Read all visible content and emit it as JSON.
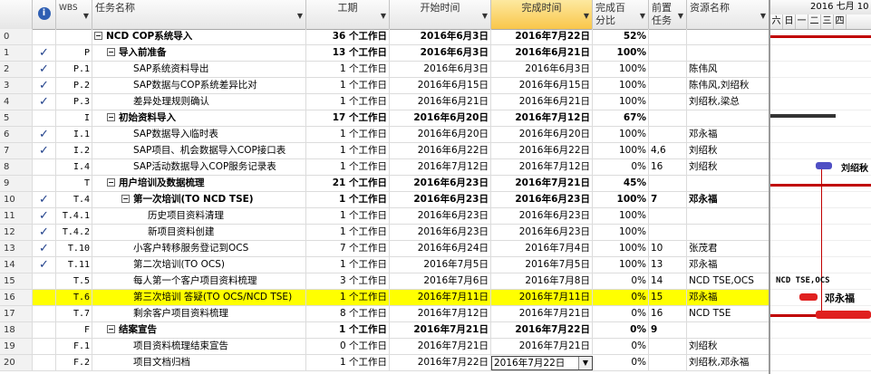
{
  "header": {
    "info": "i",
    "wbs": "WBS",
    "name": "任务名称",
    "duration": "工期",
    "start": "开始时间",
    "finish": "完成时间",
    "pct_line1": "完成百",
    "pct_line2": "分比",
    "pred_line1": "前置",
    "pred_line2": "任务",
    "resource": "资源名称"
  },
  "gantt": {
    "month_label": "2016 七月 10",
    "days": [
      "六",
      "日",
      "一",
      "二",
      "三",
      "四"
    ],
    "labels": {
      "r8": "刘绍秋",
      "r15": "NCD TSE,OCS",
      "r16": "邓永福"
    },
    "colors": {
      "summary": "#c00000",
      "task": "#4f4fc4",
      "critical": "#e0201f"
    }
  },
  "rows": [
    {
      "id": "0",
      "check": false,
      "wbs": "",
      "indent": 0,
      "toggle": "−",
      "name": "NCD COP系统导入",
      "dur": "36 个工作日",
      "start": "2016年6月3日",
      "end": "2016年7月22日",
      "pct": "52%",
      "pred": "",
      "res": "",
      "bold": true
    },
    {
      "id": "1",
      "check": true,
      "wbs": "P",
      "indent": 1,
      "toggle": "−",
      "name": "导入前准备",
      "dur": "13 个工作日",
      "start": "2016年6月3日",
      "end": "2016年6月21日",
      "pct": "100%",
      "pred": "",
      "res": "",
      "bold": true
    },
    {
      "id": "2",
      "check": true,
      "wbs": "P.1",
      "indent": 2,
      "toggle": "",
      "name": "SAP系统资料导出",
      "dur": "1 个工作日",
      "start": "2016年6月3日",
      "end": "2016年6月3日",
      "pct": "100%",
      "pred": "",
      "res": "陈伟风",
      "bold": false
    },
    {
      "id": "3",
      "check": true,
      "wbs": "P.2",
      "indent": 2,
      "toggle": "",
      "name": "SAP数据与COP系统差异比对",
      "dur": "1 个工作日",
      "start": "2016年6月15日",
      "end": "2016年6月15日",
      "pct": "100%",
      "pred": "",
      "res": "陈伟风,刘绍秋",
      "bold": false
    },
    {
      "id": "4",
      "check": true,
      "wbs": "P.3",
      "indent": 2,
      "toggle": "",
      "name": "差异处理规则确认",
      "dur": "1 个工作日",
      "start": "2016年6月21日",
      "end": "2016年6月21日",
      "pct": "100%",
      "pred": "",
      "res": "刘绍秋,梁总",
      "bold": false
    },
    {
      "id": "5",
      "check": false,
      "wbs": "I",
      "indent": 1,
      "toggle": "−",
      "name": "初始资料导入",
      "dur": "17 个工作日",
      "start": "2016年6月20日",
      "end": "2016年7月12日",
      "pct": "67%",
      "pred": "",
      "res": "",
      "bold": true
    },
    {
      "id": "6",
      "check": true,
      "wbs": "I.1",
      "indent": 2,
      "toggle": "",
      "name": "SAP数据导入临时表",
      "dur": "1 个工作日",
      "start": "2016年6月20日",
      "end": "2016年6月20日",
      "pct": "100%",
      "pred": "",
      "res": "邓永福",
      "bold": false
    },
    {
      "id": "7",
      "check": true,
      "wbs": "I.2",
      "indent": 2,
      "toggle": "",
      "name": "SAP项目、机会数据导入COP接口表",
      "dur": "1 个工作日",
      "start": "2016年6月22日",
      "end": "2016年6月22日",
      "pct": "100%",
      "pred": "4,6",
      "res": "刘绍秋",
      "bold": false
    },
    {
      "id": "8",
      "check": false,
      "wbs": "I.4",
      "indent": 2,
      "toggle": "",
      "name": "SAP活动数据导入COP服务记录表",
      "dur": "1 个工作日",
      "start": "2016年7月12日",
      "end": "2016年7月12日",
      "pct": "0%",
      "pred": "16",
      "res": "刘绍秋",
      "bold": false
    },
    {
      "id": "9",
      "check": false,
      "wbs": "T",
      "indent": 1,
      "toggle": "−",
      "name": "用户培训及数据梳理",
      "dur": "21 个工作日",
      "start": "2016年6月23日",
      "end": "2016年7月21日",
      "pct": "45%",
      "pred": "",
      "res": "",
      "bold": true
    },
    {
      "id": "10",
      "check": true,
      "wbs": "T.4",
      "indent": 2,
      "toggle": "−",
      "name": "第一次培训(TO NCD TSE)",
      "dur": "1 个工作日",
      "start": "2016年6月23日",
      "end": "2016年6月23日",
      "pct": "100%",
      "pred": "7",
      "res": "邓永福",
      "bold": true
    },
    {
      "id": "11",
      "check": true,
      "wbs": "T.4.1",
      "indent": 3,
      "toggle": "",
      "name": "历史项目资料清理",
      "dur": "1 个工作日",
      "start": "2016年6月23日",
      "end": "2016年6月23日",
      "pct": "100%",
      "pred": "",
      "res": "",
      "bold": false
    },
    {
      "id": "12",
      "check": true,
      "wbs": "T.4.2",
      "indent": 3,
      "toggle": "",
      "name": "新项目资料创建",
      "dur": "1 个工作日",
      "start": "2016年6月23日",
      "end": "2016年6月23日",
      "pct": "100%",
      "pred": "",
      "res": "",
      "bold": false
    },
    {
      "id": "13",
      "check": true,
      "wbs": "T.10",
      "indent": 2,
      "toggle": "",
      "name": "小客户转移服务登记到OCS",
      "dur": "7 个工作日",
      "start": "2016年6月24日",
      "end": "2016年7月4日",
      "pct": "100%",
      "pred": "10",
      "res": "张茂君",
      "bold": false
    },
    {
      "id": "14",
      "check": true,
      "wbs": "T.11",
      "indent": 2,
      "toggle": "",
      "name": "第二次培训(TO OCS)",
      "dur": "1 个工作日",
      "start": "2016年7月5日",
      "end": "2016年7月5日",
      "pct": "100%",
      "pred": "13",
      "res": "邓永福",
      "bold": false
    },
    {
      "id": "15",
      "check": false,
      "wbs": "T.5",
      "indent": 2,
      "toggle": "",
      "name": "每人第一个客户项目资料梳理",
      "dur": "3 个工作日",
      "start": "2016年7月6日",
      "end": "2016年7月8日",
      "pct": "0%",
      "pred": "14",
      "res": "NCD TSE,OCS",
      "bold": false
    },
    {
      "id": "16",
      "check": false,
      "wbs": "T.6",
      "indent": 2,
      "toggle": "",
      "name": "第三次培训 答疑(TO OCS/NCD TSE)",
      "dur": "1 个工作日",
      "start": "2016年7月11日",
      "end": "2016年7月11日",
      "pct": "0%",
      "pred": "15",
      "res": "邓永福",
      "bold": false,
      "highlight": true
    },
    {
      "id": "17",
      "check": false,
      "wbs": "T.7",
      "indent": 2,
      "toggle": "",
      "name": "剩余客户项目资料梳理",
      "dur": "8 个工作日",
      "start": "2016年7月12日",
      "end": "2016年7月21日",
      "pct": "0%",
      "pred": "16",
      "res": "NCD TSE",
      "bold": false
    },
    {
      "id": "18",
      "check": false,
      "wbs": "F",
      "indent": 1,
      "toggle": "−",
      "name": "结案宣告",
      "dur": "1 个工作日",
      "start": "2016年7月21日",
      "end": "2016年7月22日",
      "pct": "0%",
      "pred": "9",
      "res": "",
      "bold": true
    },
    {
      "id": "19",
      "check": false,
      "wbs": "F.1",
      "indent": 2,
      "toggle": "",
      "name": "项目资料梳理结束宣告",
      "dur": "0 个工作日",
      "start": "2016年7月21日",
      "end": "2016年7月21日",
      "pct": "0%",
      "pred": "",
      "res": "刘绍秋",
      "bold": false
    },
    {
      "id": "20",
      "check": false,
      "wbs": "F.2",
      "indent": 2,
      "toggle": "",
      "name": "项目文档归档",
      "dur": "1 个工作日",
      "start": "2016年7月22日",
      "end": "2016年7月22日",
      "pct": "0%",
      "pred": "",
      "res": "刘绍秋,邓永福",
      "bold": false,
      "editing": true
    }
  ]
}
